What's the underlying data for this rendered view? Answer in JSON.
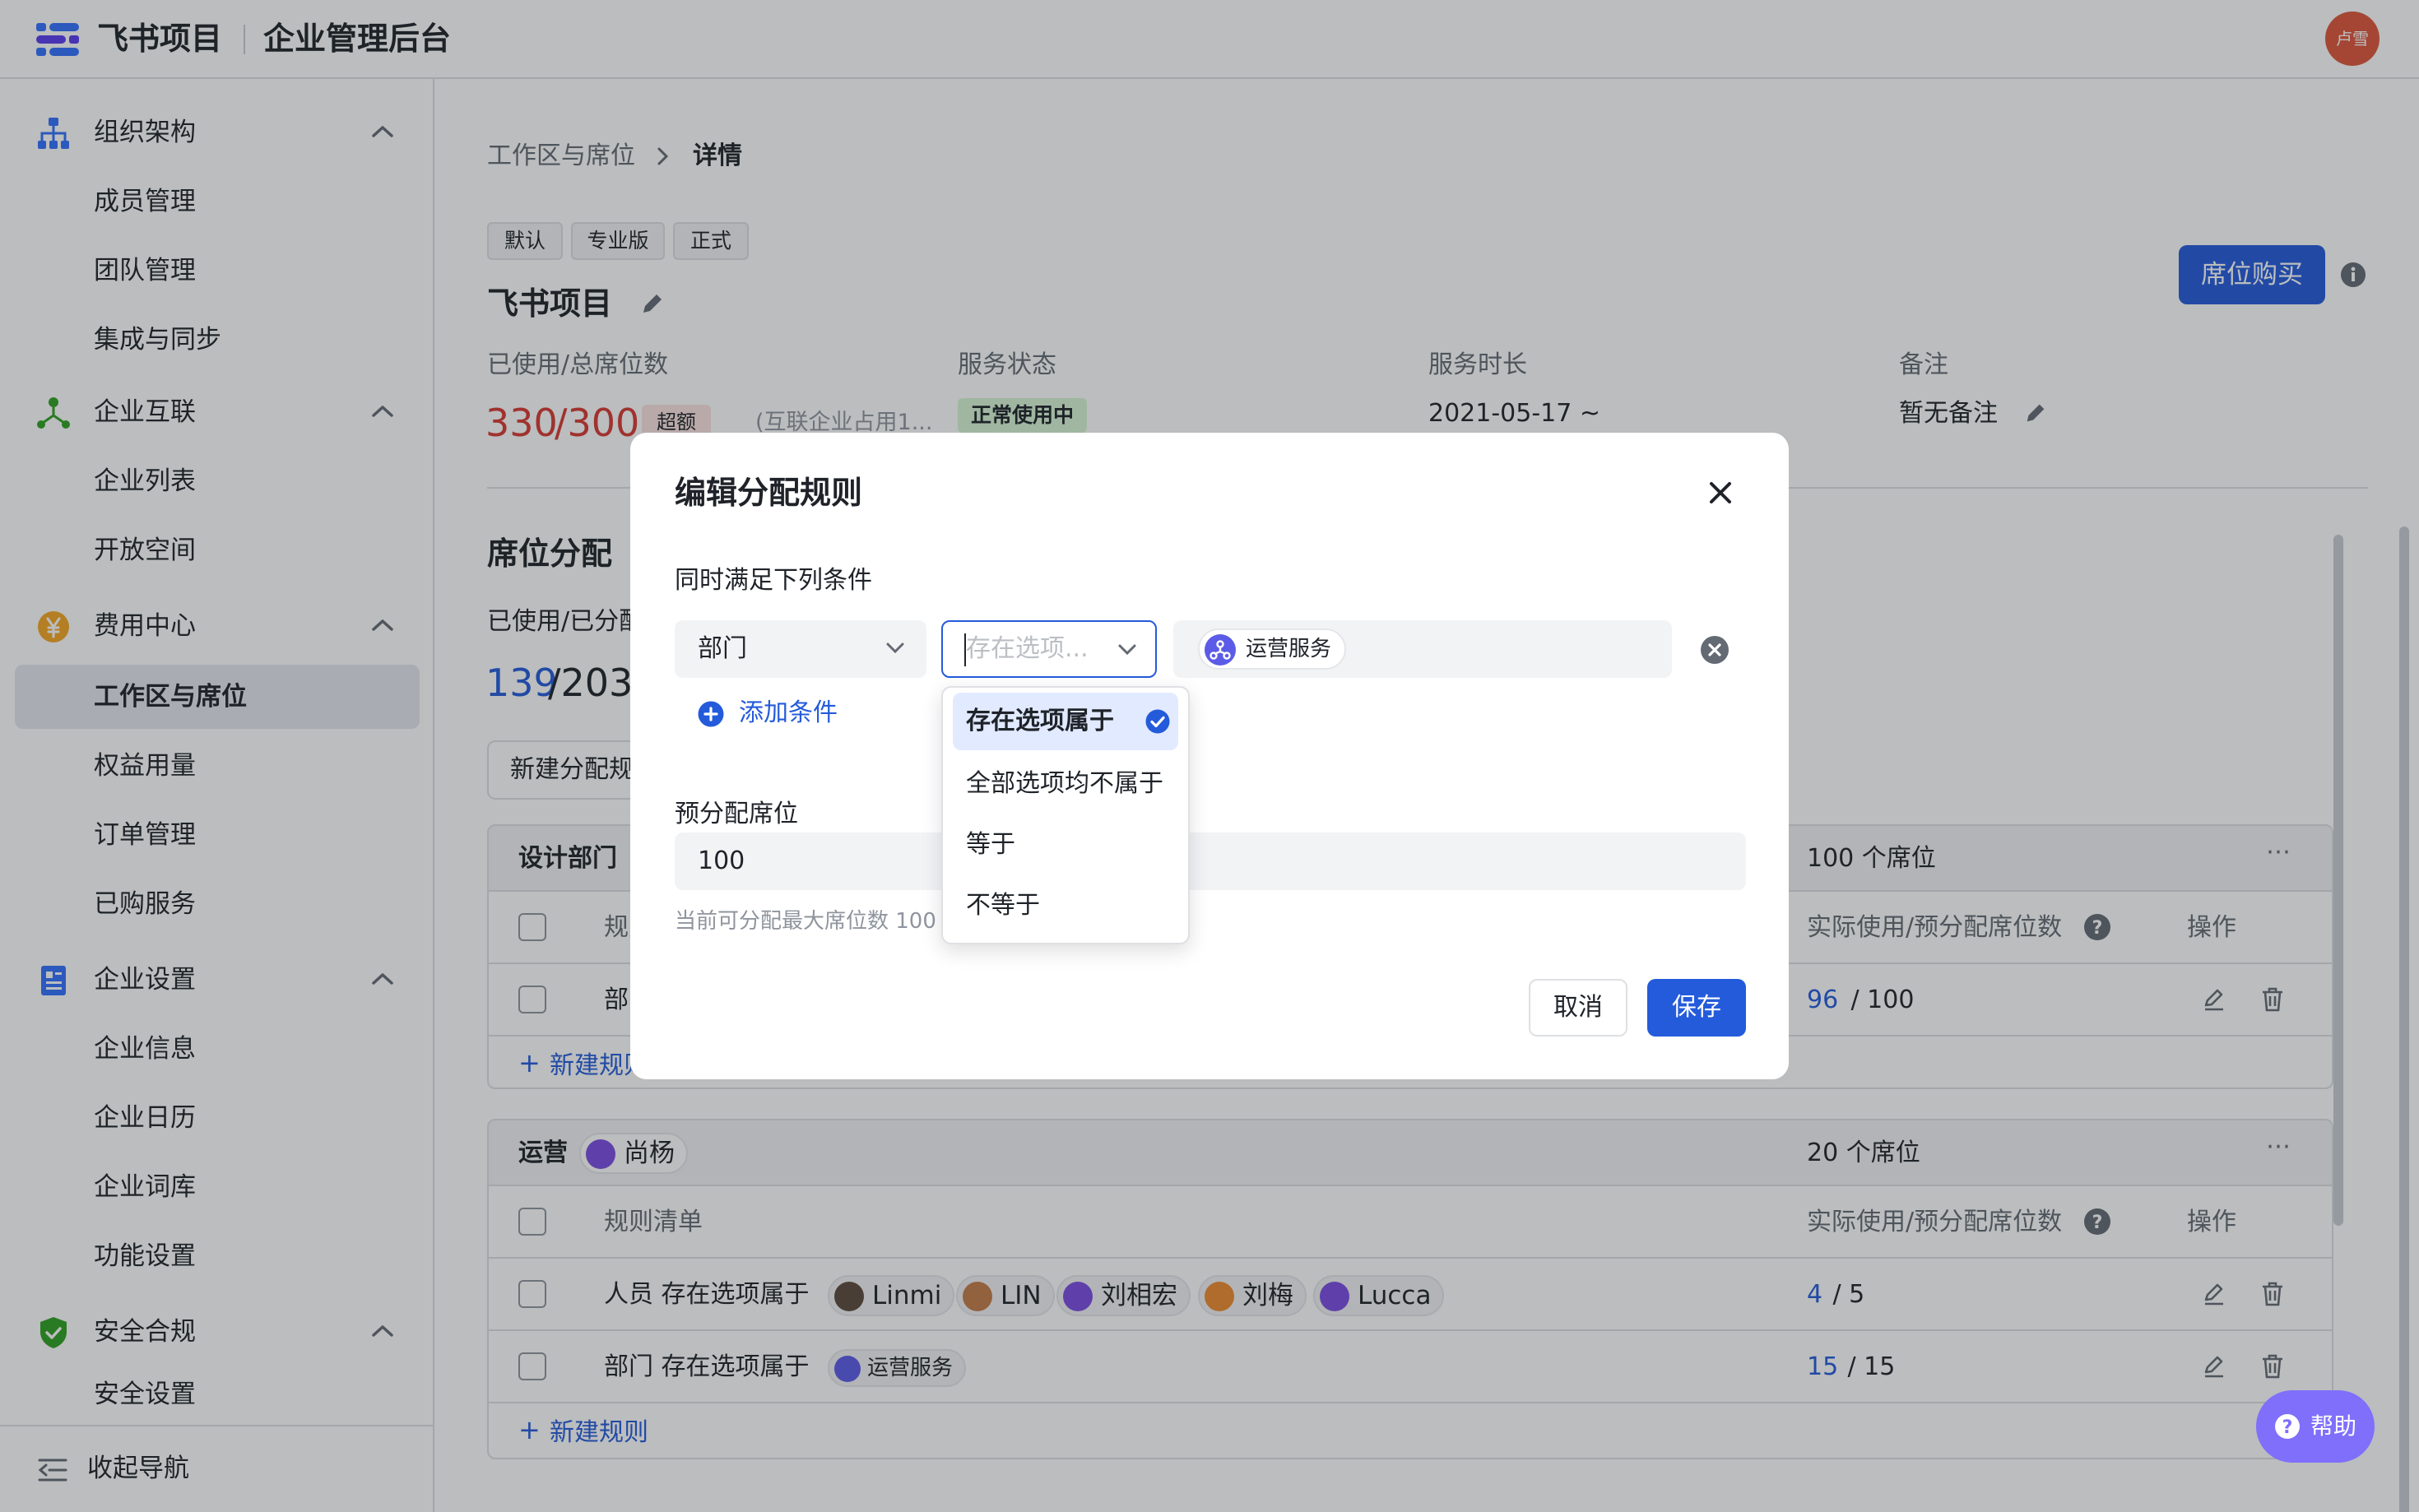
{
  "header": {
    "app_name": "飞书项目",
    "admin_title": "企业管理后台",
    "user_avatar": "卢雪"
  },
  "sidebar": {
    "sections": [
      {
        "label": "组织架构",
        "icon": "org-chart-icon",
        "items": [
          "成员管理",
          "团队管理",
          "集成与同步"
        ]
      },
      {
        "label": "企业互联",
        "icon": "network-icon",
        "items": [
          "企业列表",
          "开放空间"
        ]
      },
      {
        "label": "费用中心",
        "icon": "yen-coin-icon",
        "items": [
          "工作区与席位",
          "权益用量",
          "订单管理",
          "已购服务"
        ]
      },
      {
        "label": "企业设置",
        "icon": "company-settings-icon",
        "items": [
          "企业信息",
          "企业日历",
          "企业词库",
          "功能设置"
        ]
      },
      {
        "label": "安全合规",
        "icon": "shield-check-icon",
        "items": [
          "安全设置"
        ]
      }
    ],
    "active_item": "工作区与席位",
    "collapse_label": "收起导航"
  },
  "breadcrumb": {
    "parent": "工作区与席位",
    "current": "详情"
  },
  "workspace": {
    "tags": [
      "默认",
      "专业版",
      "正式"
    ],
    "name": "飞书项目",
    "buy_button": "席位购买",
    "stats": {
      "seats_label": "已使用/总席位数",
      "seats_used": "330",
      "seats_total": "/300",
      "over_badge": "超额",
      "seats_note": "(互联企业占用1...",
      "status_label": "服务状态",
      "status_value": "正常使用中",
      "duration_label": "服务时长",
      "duration_value": "2021-05-17 ~",
      "remark_label": "备注",
      "remark_value": "暂无备注"
    }
  },
  "allocation": {
    "title": "席位分配",
    "sub_label": "已使用/已分配",
    "used": "139",
    "allocated": "/203",
    "new_button": "新建分配规则"
  },
  "groups": [
    {
      "name": "设计部门",
      "seats": "100 个席位",
      "col_rules": "规则清单",
      "col_usage": "实际使用/预分配席位数",
      "col_actions": "操作",
      "rows": [
        {
          "rule_prefix": "部门",
          "used": "96",
          "total": " / 100"
        }
      ],
      "new_rule": "新建规则"
    },
    {
      "name": "运营",
      "owner": "尚杨",
      "seats": "20 个席位",
      "col_rules": "规则清单",
      "col_usage": "实际使用/预分配席位数",
      "col_actions": "操作",
      "rows": [
        {
          "rule": "人员 存在选项属于",
          "chips": [
            "Linmi",
            "LIN",
            "刘相宏",
            "刘梅",
            "Lucca"
          ],
          "used": "4",
          "total": " / 5"
        },
        {
          "rule": "部门 存在选项属于",
          "chips": [
            "运营服务"
          ],
          "used": "15",
          "total": " / 15"
        }
      ],
      "new_rule": "新建规则"
    }
  ],
  "modal": {
    "title": "编辑分配规则",
    "condition_label": "同时满足下列条件",
    "field_select": "部门",
    "operator_placeholder": "存在选项...",
    "value_chip": "运营服务",
    "add_condition": "添加条件",
    "seats_label": "预分配席位",
    "seats_value": "100",
    "hint": "当前可分配最大席位数 100",
    "cancel": "取消",
    "save": "保存",
    "operator_options": [
      "存在选项属于",
      "全部选项均不属于",
      "等于",
      "不等于"
    ],
    "selected_option": "存在选项属于"
  },
  "help_button": "帮助",
  "colors": {
    "primary": "#245bdb",
    "danger": "#d83931",
    "help": "#7f6ffb",
    "success_bg": "#d9f5d6"
  }
}
